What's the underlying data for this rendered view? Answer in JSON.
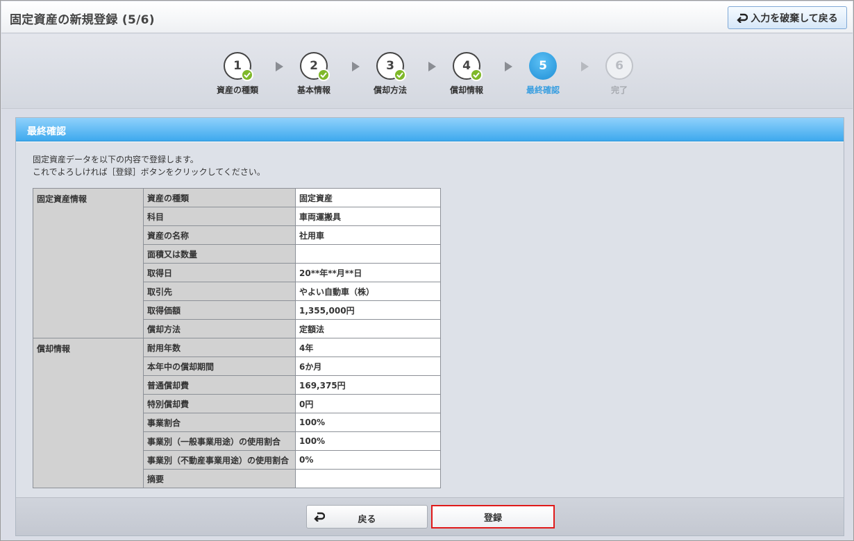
{
  "header": {
    "title": "固定資産の新規登録 (5/6)",
    "discard_label": "入力を破棄して戻る"
  },
  "steps": [
    {
      "number": "1",
      "label": "資産の種類",
      "state": "done"
    },
    {
      "number": "2",
      "label": "基本情報",
      "state": "done"
    },
    {
      "number": "3",
      "label": "償却方法",
      "state": "done"
    },
    {
      "number": "4",
      "label": "償却情報",
      "state": "done"
    },
    {
      "number": "5",
      "label": "最終確認",
      "state": "active"
    },
    {
      "number": "6",
      "label": "完了",
      "state": "disabled"
    }
  ],
  "panel": {
    "title": "最終確認",
    "intro_line1": "固定資産データを以下の内容で登録します。",
    "intro_line2": "これでよろしければ［登録］ボタンをクリックしてください。"
  },
  "table": {
    "groups": [
      "固定資産情報",
      "償却情報"
    ],
    "rows": [
      {
        "field": "資産の種類",
        "value": "固定資産"
      },
      {
        "field": "科目",
        "value": "車両運搬具"
      },
      {
        "field": "資産の名称",
        "value": "社用車"
      },
      {
        "field": "面積又は数量",
        "value": ""
      },
      {
        "field": "取得日",
        "value": "20**年**月**日"
      },
      {
        "field": "取引先",
        "value": "やよい自動車（株）"
      },
      {
        "field": "取得価額",
        "value": "1,355,000円"
      },
      {
        "field": "償却方法",
        "value": "定額法"
      },
      {
        "field": "耐用年数",
        "value": "4年"
      },
      {
        "field": "本年中の償却期間",
        "value": "6か月"
      },
      {
        "field": "普通償却費",
        "value": "169,375円"
      },
      {
        "field": "特別償却費",
        "value": "0円"
      },
      {
        "field": "事業割合",
        "value": "100%"
      },
      {
        "field": "事業別（一般事業用途）の使用割合",
        "value": "100%"
      },
      {
        "field": "事業別（不動産事業用途）の使用割合",
        "value": "0%"
      },
      {
        "field": "摘要",
        "value": ""
      }
    ]
  },
  "footer": {
    "back_label": "戻る",
    "register_label": "登録"
  },
  "colors": {
    "accent": "#3ea9ee",
    "check": "#7fb82a",
    "highlight": "#e01919"
  }
}
